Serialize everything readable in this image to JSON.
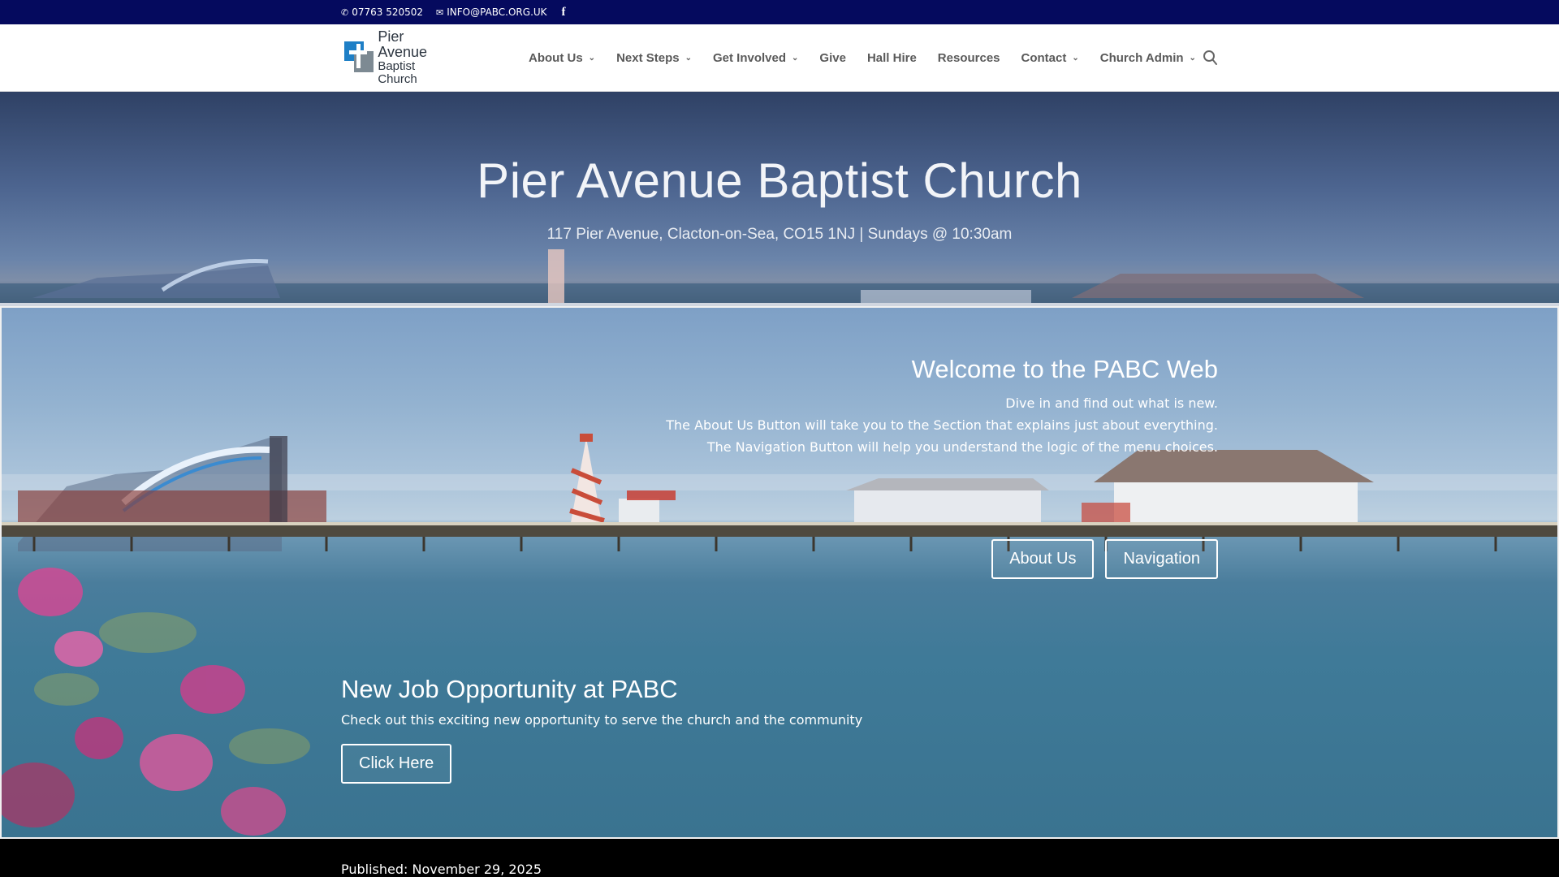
{
  "topbar": {
    "phone": "07763 520502",
    "email": "INFO@PABC.ORG.UK",
    "social_icon": "facebook-icon"
  },
  "header": {
    "logo": {
      "line1": "Pier Avenue",
      "line2": "Baptist Church"
    },
    "nav": [
      {
        "label": "About Us",
        "has_dropdown": true
      },
      {
        "label": "Next Steps",
        "has_dropdown": true
      },
      {
        "label": "Get Involved",
        "has_dropdown": true
      },
      {
        "label": "Give",
        "has_dropdown": false
      },
      {
        "label": "Hall Hire",
        "has_dropdown": false
      },
      {
        "label": "Resources",
        "has_dropdown": false
      },
      {
        "label": "Contact",
        "has_dropdown": true
      },
      {
        "label": "Church Admin",
        "has_dropdown": true
      }
    ],
    "search_icon": "search-icon"
  },
  "hero": {
    "title": "Pier Avenue  Baptist Church",
    "subtitle": "117  Pier Avenue, Clacton-on-Sea, CO15 1NJ  | Sundays @ 10:30am"
  },
  "slider": {
    "welcome": {
      "title": "Welcome to the PABC Web",
      "lines": [
        "Dive in and find out what is new.",
        "The About Us Button will take you to the Section that explains just about everything.",
        "The Navigation Button will help you understand the logic of the menu choices."
      ]
    },
    "buttons": {
      "about": "About Us",
      "navigation": "Navigation"
    },
    "job": {
      "title": "New Job Opportunity at PABC",
      "text": "Check out this exciting new opportunity to serve the church and the community",
      "button": "Click Here"
    }
  },
  "footer_strip": {
    "published": "Published: November 29, 2025"
  },
  "colors": {
    "topbar": "#050a5e",
    "accent_blue": "#1e7fc6",
    "nav_text": "#5a5a5a"
  }
}
